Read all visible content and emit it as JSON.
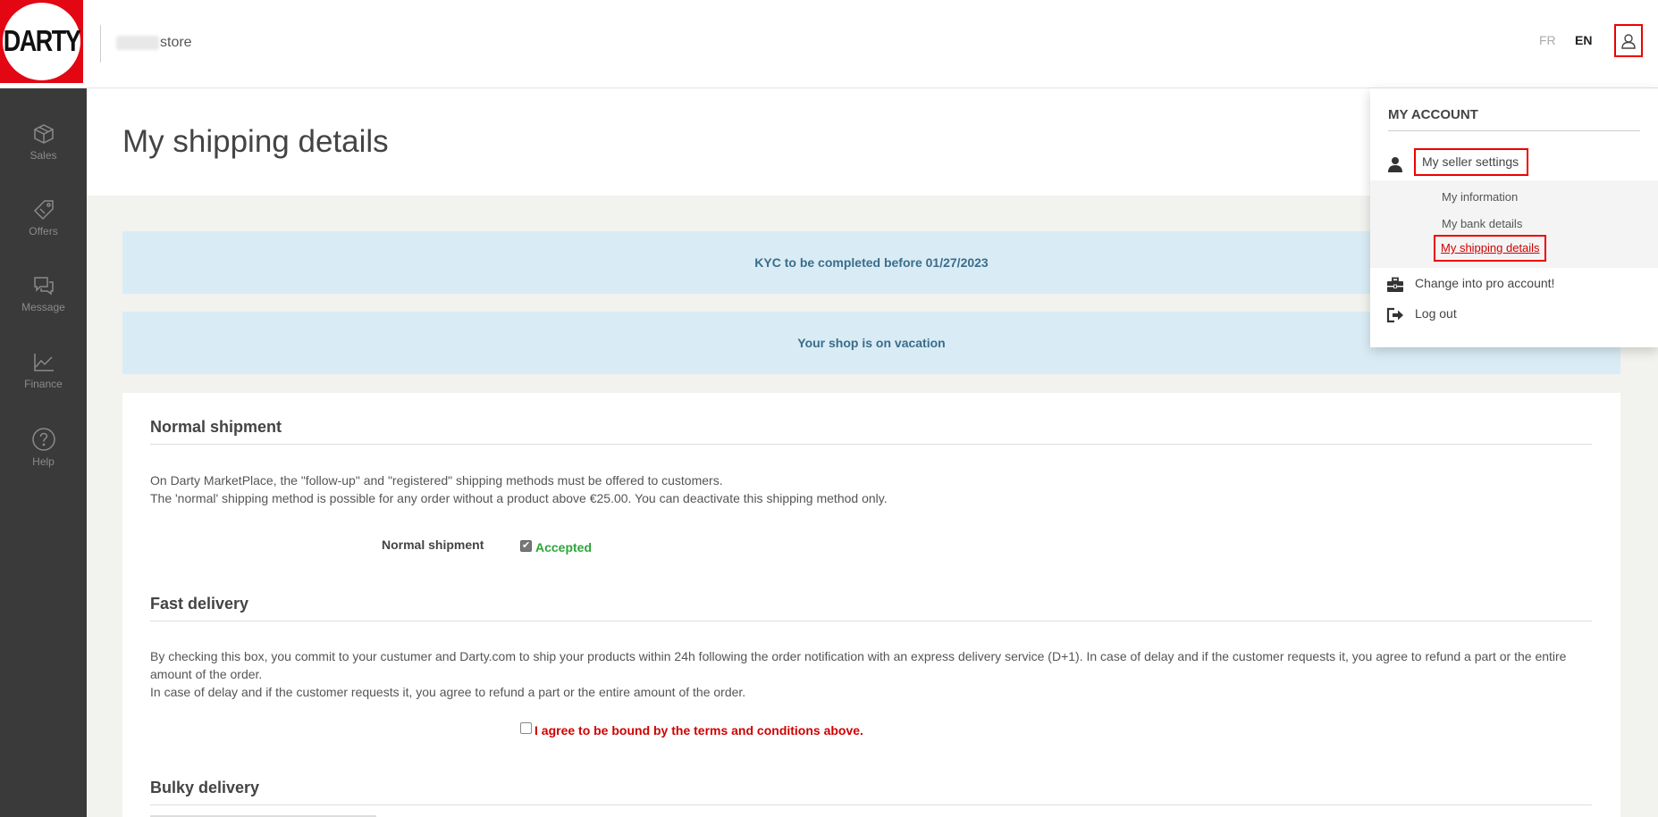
{
  "header": {
    "logo_text": "DARTY",
    "store_name": "store",
    "lang_fr": "FR",
    "lang_en": "EN"
  },
  "sidebar": {
    "items": [
      {
        "label": "Sales",
        "icon": "box-icon"
      },
      {
        "label": "Offers",
        "icon": "tag-icon"
      },
      {
        "label": "Message",
        "icon": "chat-icon"
      },
      {
        "label": "Finance",
        "icon": "chart-icon"
      },
      {
        "label": "Help",
        "icon": "help-icon"
      }
    ]
  },
  "main": {
    "title": "My shipping details",
    "kyc_banner": "KYC to be completed before 01/27/2023",
    "vacation_banner": "Your shop is on vacation",
    "normal": {
      "title": "Normal shipment",
      "line1": "On Darty MarketPlace, the \"follow-up\" and \"registered\" shipping methods must be offered to customers.",
      "line2": "The 'normal' shipping method is possible for any order without a product above €25.00. You can deactivate this shipping method only.",
      "row_label": "Normal shipment",
      "status": "Accepted"
    },
    "fast": {
      "title": "Fast delivery",
      "line1": "By checking this box, you commit to your custumer and Darty.com to ship your products within 24h following the order notification with an express delivery service (D+1). In case of delay and if the customer requests it, you agree to refund a part or the entire amount of the order.",
      "line2": "In case of delay and if the customer requests it, you agree to refund a part or the entire amount of the order.",
      "agree": "I agree to be bound by the terms and conditions above."
    },
    "bulky": {
      "title": "Bulky delivery"
    }
  },
  "account_menu": {
    "title": "MY ACCOUNT",
    "seller_settings": "My seller settings",
    "my_information": "My information",
    "my_bank_details": "My bank details",
    "my_shipping_details": "My shipping details",
    "pro_account": "Change into pro account!",
    "log_out": "Log out"
  }
}
